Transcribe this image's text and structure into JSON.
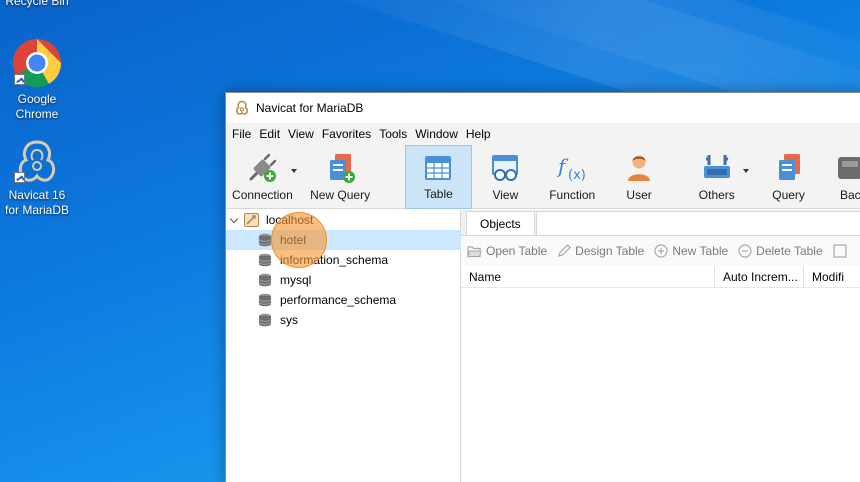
{
  "desktop": {
    "icons": [
      {
        "label": "Recycle Bin"
      },
      {
        "label": "Google Chrome"
      },
      {
        "label": "Navicat 16 for MariaDB"
      }
    ]
  },
  "window": {
    "title": "Navicat for MariaDB",
    "menu": [
      "File",
      "Edit",
      "View",
      "Favorites",
      "Tools",
      "Window",
      "Help"
    ],
    "toolbar": [
      {
        "label": "Connection",
        "icon": "connection-plug-icon",
        "dropdown": true
      },
      {
        "label": "New Query",
        "icon": "new-query-icon"
      },
      {
        "label": "Table",
        "icon": "table-icon",
        "active": true
      },
      {
        "label": "View",
        "icon": "view-glasses-icon"
      },
      {
        "label": "Function",
        "icon": "function-fx-icon"
      },
      {
        "label": "User",
        "icon": "user-icon"
      },
      {
        "label": "Others",
        "icon": "others-tools-icon",
        "dropdown": true
      },
      {
        "label": "Query",
        "icon": "query-icon"
      },
      {
        "label": "Bac",
        "icon": "backup-icon"
      }
    ],
    "navigator": {
      "connection": "localhost",
      "databases": [
        "hotel",
        "information_schema",
        "mysql",
        "performance_schema",
        "sys"
      ],
      "selected": "hotel"
    },
    "objects": {
      "tab": "Objects",
      "actions": [
        "Open Table",
        "Design Table",
        "New Table",
        "Delete Table"
      ],
      "columns": [
        "Name",
        "Auto Increm...",
        "Modifi"
      ]
    }
  },
  "colors": {
    "accent_selected": "#cce8ff",
    "toolbar_active": "#cce4f7",
    "click_indicator": "#f59836"
  }
}
